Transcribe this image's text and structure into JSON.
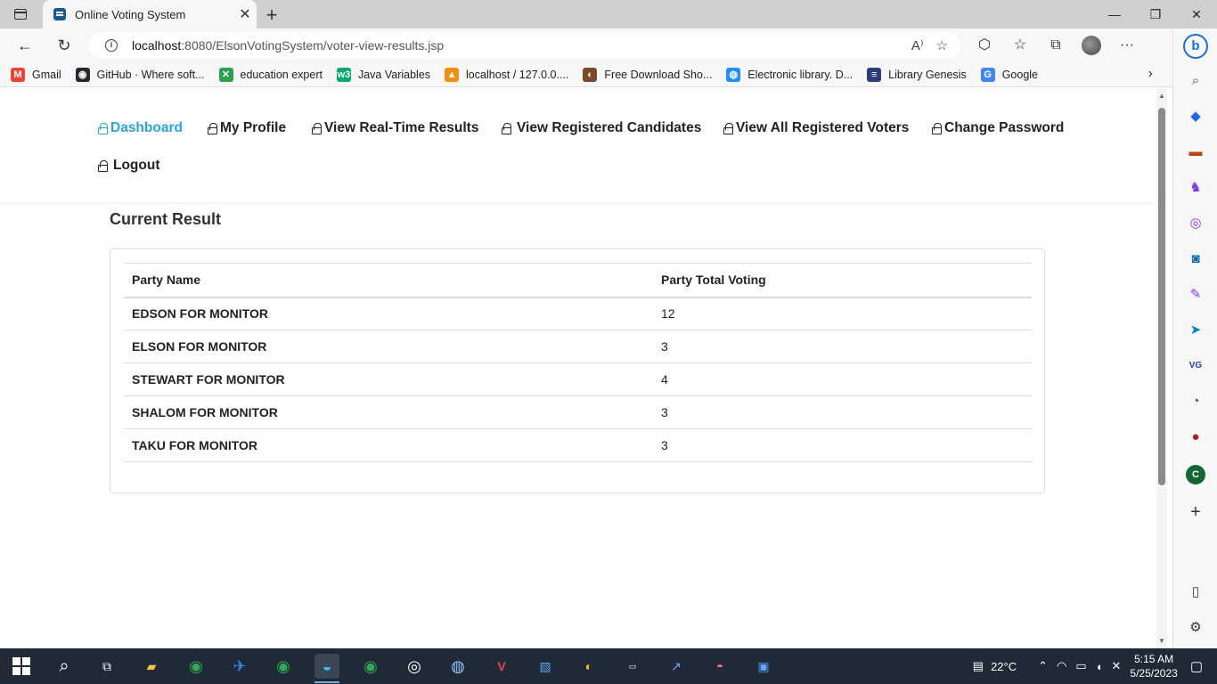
{
  "browser": {
    "tab_title": "Online Voting System",
    "url_host": "localhost",
    "url_rest": ":8080/ElsonVotingSystem/voter-view-results.jsp",
    "bookmarks": [
      {
        "label": "Gmail",
        "icon": "gmail-icon",
        "color": "#ea4335",
        "glyph": "M"
      },
      {
        "label": "GitHub · Where soft...",
        "icon": "github-icon",
        "color": "#24292f",
        "glyph": "◉"
      },
      {
        "label": "education expert",
        "icon": "education-expert-icon",
        "color": "#2e9e4f",
        "glyph": "✕"
      },
      {
        "label": "Java Variables",
        "icon": "w3schools-icon",
        "color": "#04aa6d",
        "glyph": "w3"
      },
      {
        "label": "localhost / 127.0.0....",
        "icon": "phpmyadmin-icon",
        "color": "#f29111",
        "glyph": "▲"
      },
      {
        "label": "Free Download Sho...",
        "icon": "download-site-icon",
        "color": "#7a4b2a",
        "glyph": "◐"
      },
      {
        "label": "Electronic library. D...",
        "icon": "electronic-library-icon",
        "color": "#1e90ff",
        "glyph": "◍"
      },
      {
        "label": "Library Genesis",
        "icon": "library-genesis-icon",
        "color": "#2c3e7a",
        "glyph": "≡"
      },
      {
        "label": "Google",
        "icon": "google-icon",
        "color": "#4285f4",
        "glyph": "G"
      }
    ]
  },
  "nav": {
    "dashboard": "Dashboard",
    "profile": "My Profile",
    "realtime": "View Real-Time Results",
    "candidates": "View Registered Candidates",
    "voters": "View All Registered Voters",
    "password": "Change Password",
    "logout": "Logout",
    "active_color": "#2aa7d8"
  },
  "results": {
    "title": "Current Result",
    "col_party": "Party Name",
    "col_votes": "Party Total Voting",
    "rows": [
      {
        "party": "EDSON FOR MONITOR",
        "votes": "12"
      },
      {
        "party": "ELSON FOR MONITOR",
        "votes": "3"
      },
      {
        "party": "STEWART FOR MONITOR",
        "votes": "4"
      },
      {
        "party": "SHALOM FOR MONITOR",
        "votes": "3"
      },
      {
        "party": "TAKU FOR MONITOR",
        "votes": "3"
      }
    ]
  },
  "taskbar": {
    "temperature": "22°C",
    "time": "5:15 AM",
    "date": "5/25/2023"
  }
}
